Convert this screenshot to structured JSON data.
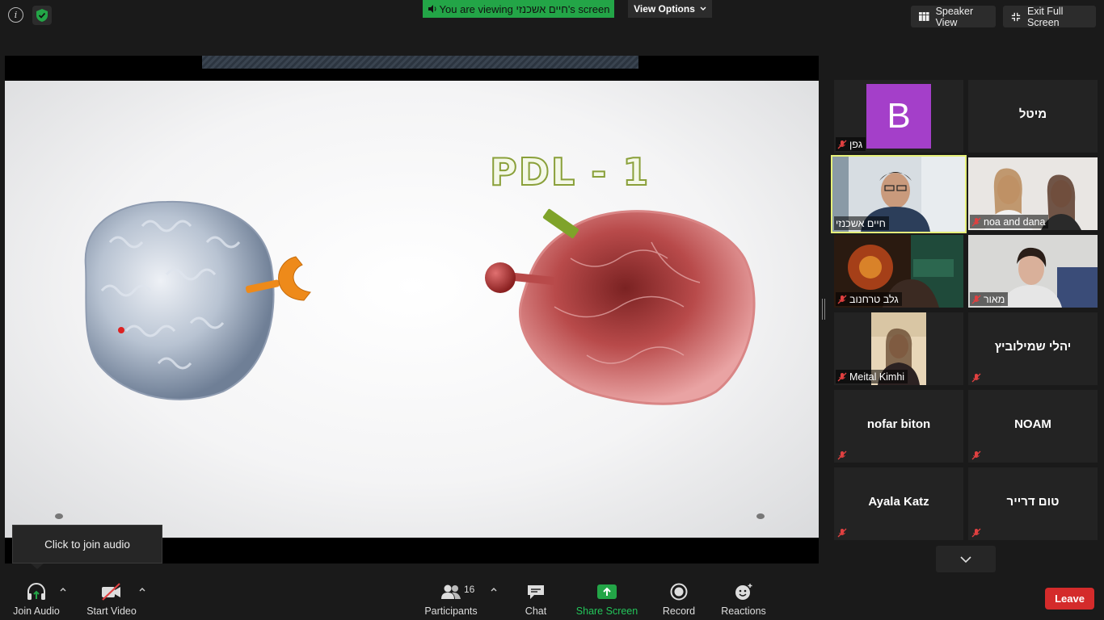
{
  "top_bar": {
    "info_icon": "i",
    "banner_text": "You are viewing חיים אשכנזי's screen",
    "view_options_label": "View Options",
    "speaker_view_label": "Speaker View",
    "exit_fullscreen_label": "Exit Full Screen"
  },
  "shared_screen": {
    "slide_title": "PDL - 1",
    "colors": {
      "tcell": "#b8c3d2",
      "cancer_cell": "#b84a4a",
      "receptor_orange": "#ee8a1a",
      "pdl_green": "#7fa32a"
    }
  },
  "tooltip": {
    "text": "Click to join audio"
  },
  "gallery": {
    "tiles": [
      {
        "name": "גפן",
        "avatar_letter": "B",
        "muted": true
      },
      {
        "name": "מיטל",
        "muted": false
      },
      {
        "name": "חיים אשכנזי",
        "muted": false,
        "active_speaker": true
      },
      {
        "name": "noa and dana",
        "muted": true
      },
      {
        "name": "גלב טרחנוב",
        "muted": true
      },
      {
        "name": "מאור",
        "muted": true
      },
      {
        "name": "Meital Kimhi",
        "muted": true
      },
      {
        "name": "יהלי שמילוביץ",
        "muted": true
      },
      {
        "name": "nofar biton",
        "muted": true
      },
      {
        "name": "NOAM",
        "muted": true
      },
      {
        "name": "Ayala Katz",
        "muted": true
      },
      {
        "name": "טום דרייר",
        "muted": true
      }
    ]
  },
  "toolbar": {
    "join_audio": "Join Audio",
    "start_video": "Start Video",
    "participants": "Participants",
    "participants_count": "16",
    "chat": "Chat",
    "share_screen": "Share Screen",
    "record": "Record",
    "reactions": "Reactions",
    "leave": "Leave"
  }
}
